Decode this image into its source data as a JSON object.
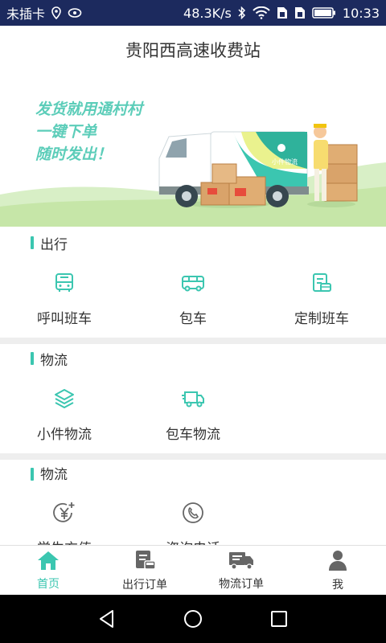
{
  "status_bar": {
    "carrier": "未插卡",
    "net_speed": "48.3K/s",
    "time": "10:33",
    "icons": [
      "location-icon",
      "eye-icon",
      "bluetooth-icon",
      "wifi-icon",
      "sim-icon",
      "sim-icon",
      "battery-icon"
    ]
  },
  "header": {
    "title": "贵阳西高速收费站"
  },
  "banner": {
    "slogan_lines": [
      "发货就用通村村",
      "一键下单",
      "随时发出！"
    ],
    "truck_text": "小件物流"
  },
  "sections": [
    {
      "title": "出行",
      "items": [
        {
          "label": "呼叫班车",
          "icon": "bus-icon"
        },
        {
          "label": "包车",
          "icon": "charter-bus-icon"
        },
        {
          "label": "定制班车",
          "icon": "custom-bus-icon"
        }
      ]
    },
    {
      "title": "物流",
      "items": [
        {
          "label": "小件物流",
          "icon": "layers-icon"
        },
        {
          "label": "包车物流",
          "icon": "truck-icon"
        }
      ]
    },
    {
      "title": "物流",
      "items": [
        {
          "label": "学生充值",
          "icon": "yuan-plus-icon"
        },
        {
          "label": "咨询电话",
          "icon": "phone-icon"
        }
      ]
    }
  ],
  "tabbar": {
    "tabs": [
      {
        "label": "首页",
        "icon": "home-icon",
        "active": true
      },
      {
        "label": "出行订单",
        "icon": "bus-order-icon",
        "active": false
      },
      {
        "label": "物流订单",
        "icon": "truck-order-icon",
        "active": false
      },
      {
        "label": "我",
        "icon": "user-icon",
        "active": false
      }
    ]
  },
  "navbar": {
    "icons": [
      "back-icon",
      "home-circle-icon",
      "recents-icon"
    ]
  },
  "colors": {
    "accent": "#3bc6b0",
    "status_bar": "#1c2a5e",
    "text": "#333333",
    "separator": "#eeeeee"
  }
}
